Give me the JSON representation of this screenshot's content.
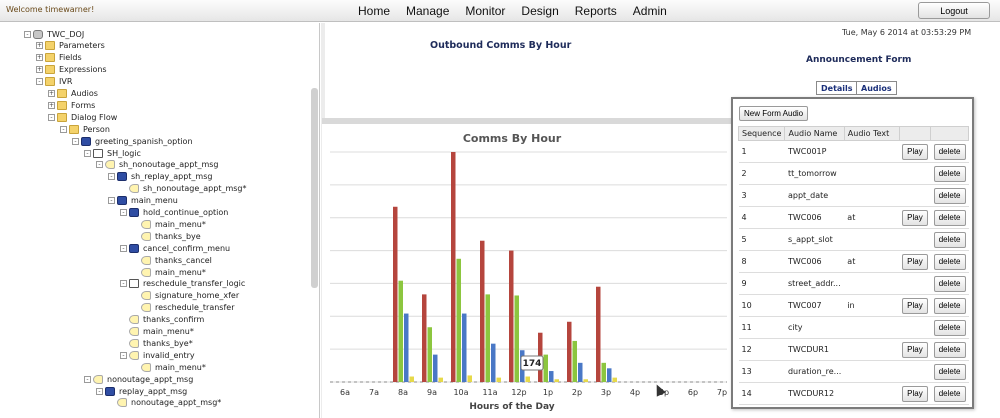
{
  "header": {
    "welcome": "Welcome timewarner!",
    "nav": [
      "Home",
      "Manage",
      "Monitor",
      "Design",
      "Reports",
      "Admin"
    ],
    "logout_label": "Logout"
  },
  "tree": [
    {
      "label": "TWC_DOJ",
      "icon": "db",
      "level": 0,
      "toggle": "-"
    },
    {
      "label": "Parameters",
      "icon": "folder",
      "level": 1,
      "toggle": "+"
    },
    {
      "label": "Fields",
      "icon": "folder",
      "level": 1,
      "toggle": "+"
    },
    {
      "label": "Expressions",
      "icon": "folder",
      "level": 1,
      "toggle": "+"
    },
    {
      "label": "IVR",
      "icon": "folder",
      "level": 1,
      "toggle": "-"
    },
    {
      "label": "Audios",
      "icon": "folder",
      "level": 2,
      "toggle": "+"
    },
    {
      "label": "Forms",
      "icon": "folder",
      "level": 2,
      "toggle": "+"
    },
    {
      "label": "Dialog Flow",
      "icon": "folder",
      "level": 2,
      "toggle": "-"
    },
    {
      "label": "Person",
      "icon": "folder",
      "level": 3,
      "toggle": "-"
    },
    {
      "label": "greeting_spanish_option",
      "icon": "flow",
      "level": 4,
      "toggle": "-"
    },
    {
      "label": "SH_logic",
      "icon": "node",
      "level": 5,
      "toggle": "-"
    },
    {
      "label": "sh_nonoutage_appt_msg",
      "icon": "audio",
      "level": 6,
      "toggle": "-"
    },
    {
      "label": "sh_replay_appt_msg",
      "icon": "flow",
      "level": 7,
      "toggle": "-"
    },
    {
      "label": "sh_nonoutage_appt_msg*",
      "icon": "audio",
      "level": 8,
      "toggle": ""
    },
    {
      "label": "main_menu",
      "icon": "flow",
      "level": 7,
      "toggle": "-"
    },
    {
      "label": "hold_continue_option",
      "icon": "flow",
      "level": 8,
      "toggle": "-"
    },
    {
      "label": "main_menu*",
      "icon": "audio",
      "level": 9,
      "toggle": ""
    },
    {
      "label": "thanks_bye",
      "icon": "audio",
      "level": 9,
      "toggle": ""
    },
    {
      "label": "cancel_confirm_menu",
      "icon": "flow",
      "level": 8,
      "toggle": "-"
    },
    {
      "label": "thanks_cancel",
      "icon": "audio",
      "level": 9,
      "toggle": ""
    },
    {
      "label": "main_menu*",
      "icon": "audio",
      "level": 9,
      "toggle": ""
    },
    {
      "label": "reschedule_transfer_logic",
      "icon": "node",
      "level": 8,
      "toggle": "-"
    },
    {
      "label": "signature_home_xfer",
      "icon": "audio",
      "level": 9,
      "toggle": ""
    },
    {
      "label": "reschedule_transfer",
      "icon": "audio",
      "level": 9,
      "toggle": ""
    },
    {
      "label": "thanks_confirm",
      "icon": "audio",
      "level": 8,
      "toggle": ""
    },
    {
      "label": "main_menu*",
      "icon": "audio",
      "level": 8,
      "toggle": ""
    },
    {
      "label": "thanks_bye*",
      "icon": "audio",
      "level": 8,
      "toggle": ""
    },
    {
      "label": "invalid_entry",
      "icon": "audio",
      "level": 8,
      "toggle": "-"
    },
    {
      "label": "main_menu*",
      "icon": "audio",
      "level": 9,
      "toggle": ""
    },
    {
      "label": "nonoutage_appt_msg",
      "icon": "audio",
      "level": 5,
      "toggle": "-"
    },
    {
      "label": "replay_appt_msg",
      "icon": "flow",
      "level": 6,
      "toggle": "-"
    },
    {
      "label": "nonoutage_appt_msg*",
      "icon": "audio",
      "level": 7,
      "toggle": ""
    }
  ],
  "main": {
    "title": "Outbound Comms By Hour",
    "timestamp": "Tue, May 6 2014 at 03:53:29 PM",
    "form_title": "Announcement Form",
    "tabs": [
      "Details",
      "Audios"
    ]
  },
  "chart_data": {
    "type": "bar",
    "title": "Comms By Hour",
    "xlabel": "Hours of the Day",
    "ylabel": "",
    "categories": [
      "6a",
      "7a",
      "8a",
      "9a",
      "10a",
      "11a",
      "12p",
      "1p",
      "2p",
      "3p",
      "4p",
      "5p",
      "6p",
      "7p"
    ],
    "ylim": [
      0,
      420
    ],
    "grid": true,
    "series": [
      {
        "color": "#b5453d",
        "values": [
          0,
          0,
          320,
          160,
          420,
          258,
          240,
          90,
          110,
          174,
          0,
          0,
          0,
          0
        ]
      },
      {
        "color": "#8cc63f",
        "values": [
          0,
          0,
          185,
          100,
          225,
          160,
          158,
          50,
          75,
          35,
          0,
          0,
          0,
          0
        ]
      },
      {
        "color": "#4a78c6",
        "values": [
          0,
          0,
          125,
          50,
          125,
          70,
          58,
          20,
          35,
          25,
          0,
          0,
          0,
          0
        ]
      },
      {
        "color": "#e6d94a",
        "values": [
          0,
          0,
          10,
          8,
          12,
          8,
          10,
          5,
          5,
          8,
          0,
          0,
          0,
          0
        ]
      }
    ],
    "annotation": "174"
  },
  "audios": {
    "new_button": "New Form Audio",
    "headers": [
      "Sequence",
      "Audio Name",
      "Audio Text"
    ],
    "play_label": "Play",
    "delete_label": "delete",
    "rows": [
      {
        "seq": "1",
        "name": "TWC001P",
        "text": "",
        "play": true
      },
      {
        "seq": "2",
        "name": "tt_tomorrow",
        "text": "",
        "play": false
      },
      {
        "seq": "3",
        "name": "appt_date",
        "text": "",
        "play": false
      },
      {
        "seq": "4",
        "name": "TWC006",
        "text": "at",
        "play": true
      },
      {
        "seq": "5",
        "name": "s_appt_slot",
        "text": "",
        "play": false
      },
      {
        "seq": "8",
        "name": "TWC006",
        "text": "at",
        "play": true
      },
      {
        "seq": "9",
        "name": "street_addr...",
        "text": "",
        "play": false
      },
      {
        "seq": "10",
        "name": "TWC007",
        "text": "in",
        "play": true
      },
      {
        "seq": "11",
        "name": "city",
        "text": "",
        "play": false
      },
      {
        "seq": "12",
        "name": "TWCDUR1",
        "text": "",
        "play": true
      },
      {
        "seq": "13",
        "name": "duration_re...",
        "text": "",
        "play": false
      },
      {
        "seq": "14",
        "name": "TWCDUR12",
        "text": "",
        "play": true
      }
    ]
  }
}
